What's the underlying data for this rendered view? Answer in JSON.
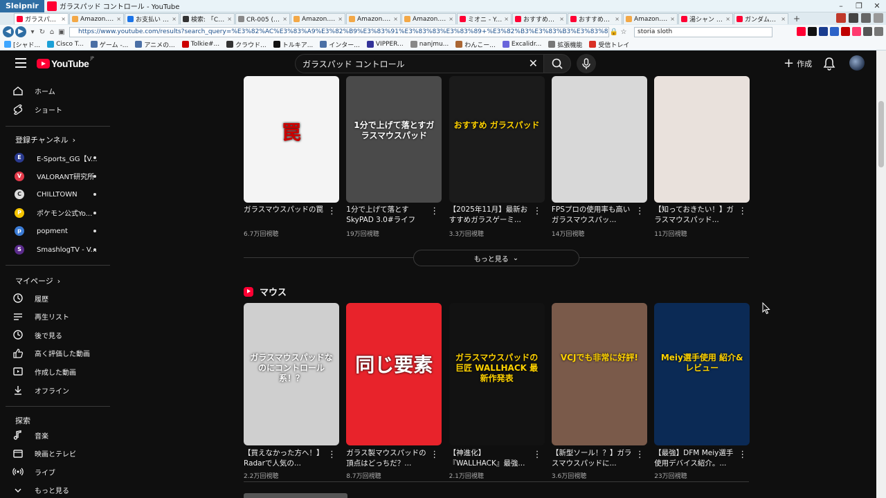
{
  "browser": {
    "app_logo": "Sleipnir",
    "window_title": "ガラスパッド コントロール - YouTube",
    "window_controls": [
      "–",
      "❐",
      "✕"
    ],
    "tabs": [
      {
        "label": "ガラスパッド コント...",
        "color": "#ff0033",
        "active": true
      },
      {
        "label": "Amazon.co.jp:...",
        "color": "#f3a847"
      },
      {
        "label": "お支払い - WAL...",
        "color": "#1a73e8"
      },
      {
        "label": "検索: 「CR005」の...",
        "color": "#333333"
      },
      {
        "label": "CR-005 (ブラック)...",
        "color": "#888888"
      },
      {
        "label": "Amazon.co.jp:...",
        "color": "#f3a847"
      },
      {
        "label": "Amazon.co.jp:...",
        "color": "#f3a847"
      },
      {
        "label": "Amazon.co.jp :...",
        "color": "#f3a847"
      },
      {
        "label": "ミオニ - YouTube",
        "color": "#ff0033"
      },
      {
        "label": "おすすめのゲーミ...",
        "color": "#ff0033"
      },
      {
        "label": "おすすめのゲーミ...",
        "color": "#ff0033"
      },
      {
        "label": "Amazon.co.jp:S...",
        "color": "#f3a847"
      },
      {
        "label": "湯シャン - YouTu...",
        "color": "#ff0033"
      },
      {
        "label": "ガンダムチャンネル...",
        "color": "#ff0033"
      }
    ],
    "new_tab": "+",
    "url": "https://www.youtube.com/results?search_query=%E3%82%AC%E3%83%A9%E3%82%B9%E3%83%91%E3%83%83%E3%83%89+%E3%82%B3%E3%83%B3%E3%83%88%E3%83%AD%E3%83%BC%E3%83%AB",
    "search_field": "storia sloth",
    "bookmarks": [
      {
        "label": "[シャド...",
        "color": "#3ea6ff"
      },
      {
        "label": "Cisco T...",
        "color": "#1ba0d7"
      },
      {
        "label": "ゲーム -...",
        "color": "#4a6fa5"
      },
      {
        "label": "アニメの...",
        "color": "#4a6fa5"
      },
      {
        "label": "Tolkie#...",
        "color": "#cc0000"
      },
      {
        "label": "クラウド...",
        "color": "#333333"
      },
      {
        "label": "トルキア...",
        "color": "#111111"
      },
      {
        "label": "インター...",
        "color": "#4a6fa5"
      },
      {
        "label": "VIPPER...",
        "color": "#333399"
      },
      {
        "label": "nanjmu...",
        "color": "#888888"
      },
      {
        "label": "わんこー...",
        "color": "#aa6633"
      },
      {
        "label": "Excalidr...",
        "color": "#6965db"
      },
      {
        "label": "拡張機能",
        "color": "#777777"
      },
      {
        "label": "受信トレイ",
        "color": "#d93025"
      }
    ]
  },
  "youtube": {
    "logo_word": "YouTube",
    "logo_region": "JP",
    "search_query": "ガラスパッド コントロール",
    "create_label": "作成",
    "sidebar": {
      "main": [
        {
          "label": "ホーム",
          "icon": "home-icon"
        },
        {
          "label": "ショート",
          "icon": "shorts-icon"
        }
      ],
      "subscriptions_heading": "登録チャンネル",
      "channels": [
        {
          "label": "E-Sports_GG【V...",
          "color": "#2a3a8f",
          "initial": "E"
        },
        {
          "label": "VALORANT研究所",
          "color": "#e23a4a",
          "initial": "V"
        },
        {
          "label": "CHILLTOWN",
          "color": "#dddddd",
          "initial": "C"
        },
        {
          "label": "ポケモン公式Yo...",
          "color": "#f5c400",
          "initial": "P"
        },
        {
          "label": "popment",
          "color": "#3a7bd5",
          "initial": "p"
        },
        {
          "label": "SmashlogTV - V...",
          "color": "#5a2a8a",
          "initial": "S"
        }
      ],
      "you_heading": "マイページ",
      "you_items": [
        {
          "label": "履歴",
          "icon": "history-icon"
        },
        {
          "label": "再生リスト",
          "icon": "playlist-icon"
        },
        {
          "label": "後で見る",
          "icon": "watch-later-icon"
        },
        {
          "label": "高く評価した動画",
          "icon": "thumbs-up-icon"
        },
        {
          "label": "作成した動画",
          "icon": "your-videos-icon"
        },
        {
          "label": "オフライン",
          "icon": "download-icon"
        }
      ],
      "explore_heading": "探索",
      "explore_items": [
        {
          "label": "音楽",
          "icon": "music-icon"
        },
        {
          "label": "映画とテレビ",
          "icon": "movies-icon"
        },
        {
          "label": "ライブ",
          "icon": "live-icon"
        },
        {
          "label": "もっと見る",
          "icon": "chevron-down-icon"
        }
      ]
    },
    "row1": [
      {
        "title": "ガラスマウスパッドの罠",
        "meta": "6.7万回視聴",
        "thumb_text": "罠",
        "bg": "#f4f4f4",
        "fg": "#cc0000"
      },
      {
        "title": "1分で上げて落とすSkyPAD 3.0#ライフハ...",
        "meta": "19万回視聴",
        "thumb_text": "1分で上げて落とすガラスマウスパッド",
        "bg": "#4a4a4a",
        "fg": "#ffffff"
      },
      {
        "title": "【2025年11月】最新おすすめガラスゲーミ...",
        "meta": "3.3万回視聴",
        "thumb_text": "おすすめ ガラスパッド",
        "bg": "#1b1b1b",
        "fg": "#ffd200"
      },
      {
        "title": "FPSプロの使用率も高いガラスマウスパッ...",
        "meta": "14万回視聴",
        "thumb_text": "",
        "bg": "#d8d8d8",
        "fg": "#222222"
      },
      {
        "title": "【知っておきたい！】ガラスマウスパッド...",
        "meta": "11万回視聴",
        "thumb_text": "",
        "bg": "#e9e1dc",
        "fg": "#333333"
      }
    ],
    "more_label": "もっと見る",
    "shelf_title": "マウス",
    "row2": [
      {
        "title": "【買えなかった方へ！】Radarで人気の...",
        "meta": "2.2万回視聴",
        "thumb_text": "ガラスマウスパッドなのにコントロール系！？",
        "bg": "#cfcfcf",
        "fg": "#ffffff"
      },
      {
        "title": "ガラス製マウスパッドの頂点はどっちだ？...",
        "meta": "8.7万回視聴",
        "thumb_text": "同じ要素",
        "bg": "#e8232b",
        "fg": "#ffffff"
      },
      {
        "title": "【神進化】『WALLHACK』最強...",
        "meta": "2.1万回視聴",
        "thumb_text": "ガラスマウスパッドの巨匠 WALLHACK 最新作発表",
        "bg": "#121212",
        "fg": "#ffd200"
      },
      {
        "title": "【新型ソール！？】ガラスマウスパッドに...",
        "meta": "3.6万回視聴",
        "thumb_text": "VCJでも非常に好評!",
        "bg": "#7a5a4a",
        "fg": "#ffd200"
      },
      {
        "title": "【最強】DFM Meiy選手使用デバイス紹介。...",
        "meta": "23万回視聴",
        "thumb_text": "Meiy選手使用 紹介&レビュー",
        "bg": "#0b2a55",
        "fg": "#ffd200"
      }
    ]
  }
}
